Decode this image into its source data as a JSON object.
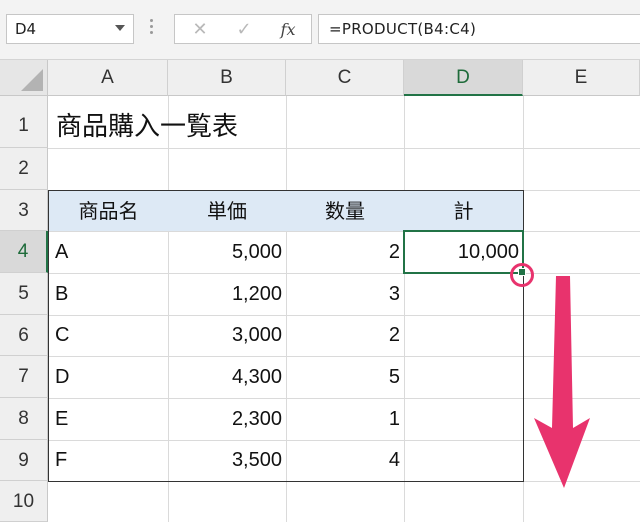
{
  "formula_bar": {
    "name_box": "D4",
    "cancel_icon": "✕",
    "enter_icon": "✓",
    "fx_icon": "fx",
    "formula": "=PRODUCT(B4:C4)"
  },
  "columns": [
    "A",
    "B",
    "C",
    "D",
    "E"
  ],
  "rows": [
    "1",
    "2",
    "3",
    "4",
    "5",
    "6",
    "7",
    "8",
    "9",
    "10"
  ],
  "sheet": {
    "title": "商品購入一覧表",
    "headers": [
      "商品名",
      "単価",
      "数量",
      "計"
    ],
    "items": [
      {
        "name": "A",
        "price": "5,000",
        "qty": "2",
        "total": "10,000"
      },
      {
        "name": "B",
        "price": "1,200",
        "qty": "3",
        "total": ""
      },
      {
        "name": "C",
        "price": "3,000",
        "qty": "2",
        "total": ""
      },
      {
        "name": "D",
        "price": "4,300",
        "qty": "5",
        "total": ""
      },
      {
        "name": "E",
        "price": "2,300",
        "qty": "1",
        "total": ""
      },
      {
        "name": "F",
        "price": "3,500",
        "qty": "4",
        "total": ""
      }
    ]
  },
  "selected_cell": "D4",
  "annotation": {
    "ring_color": "#e8336d",
    "arrow_color": "#e8336d",
    "icons": [
      "fill-handle-highlight-ring",
      "drag-down-arrow"
    ]
  },
  "colors": {
    "excel_green": "#217346",
    "header_fill": "#dde9f5"
  }
}
